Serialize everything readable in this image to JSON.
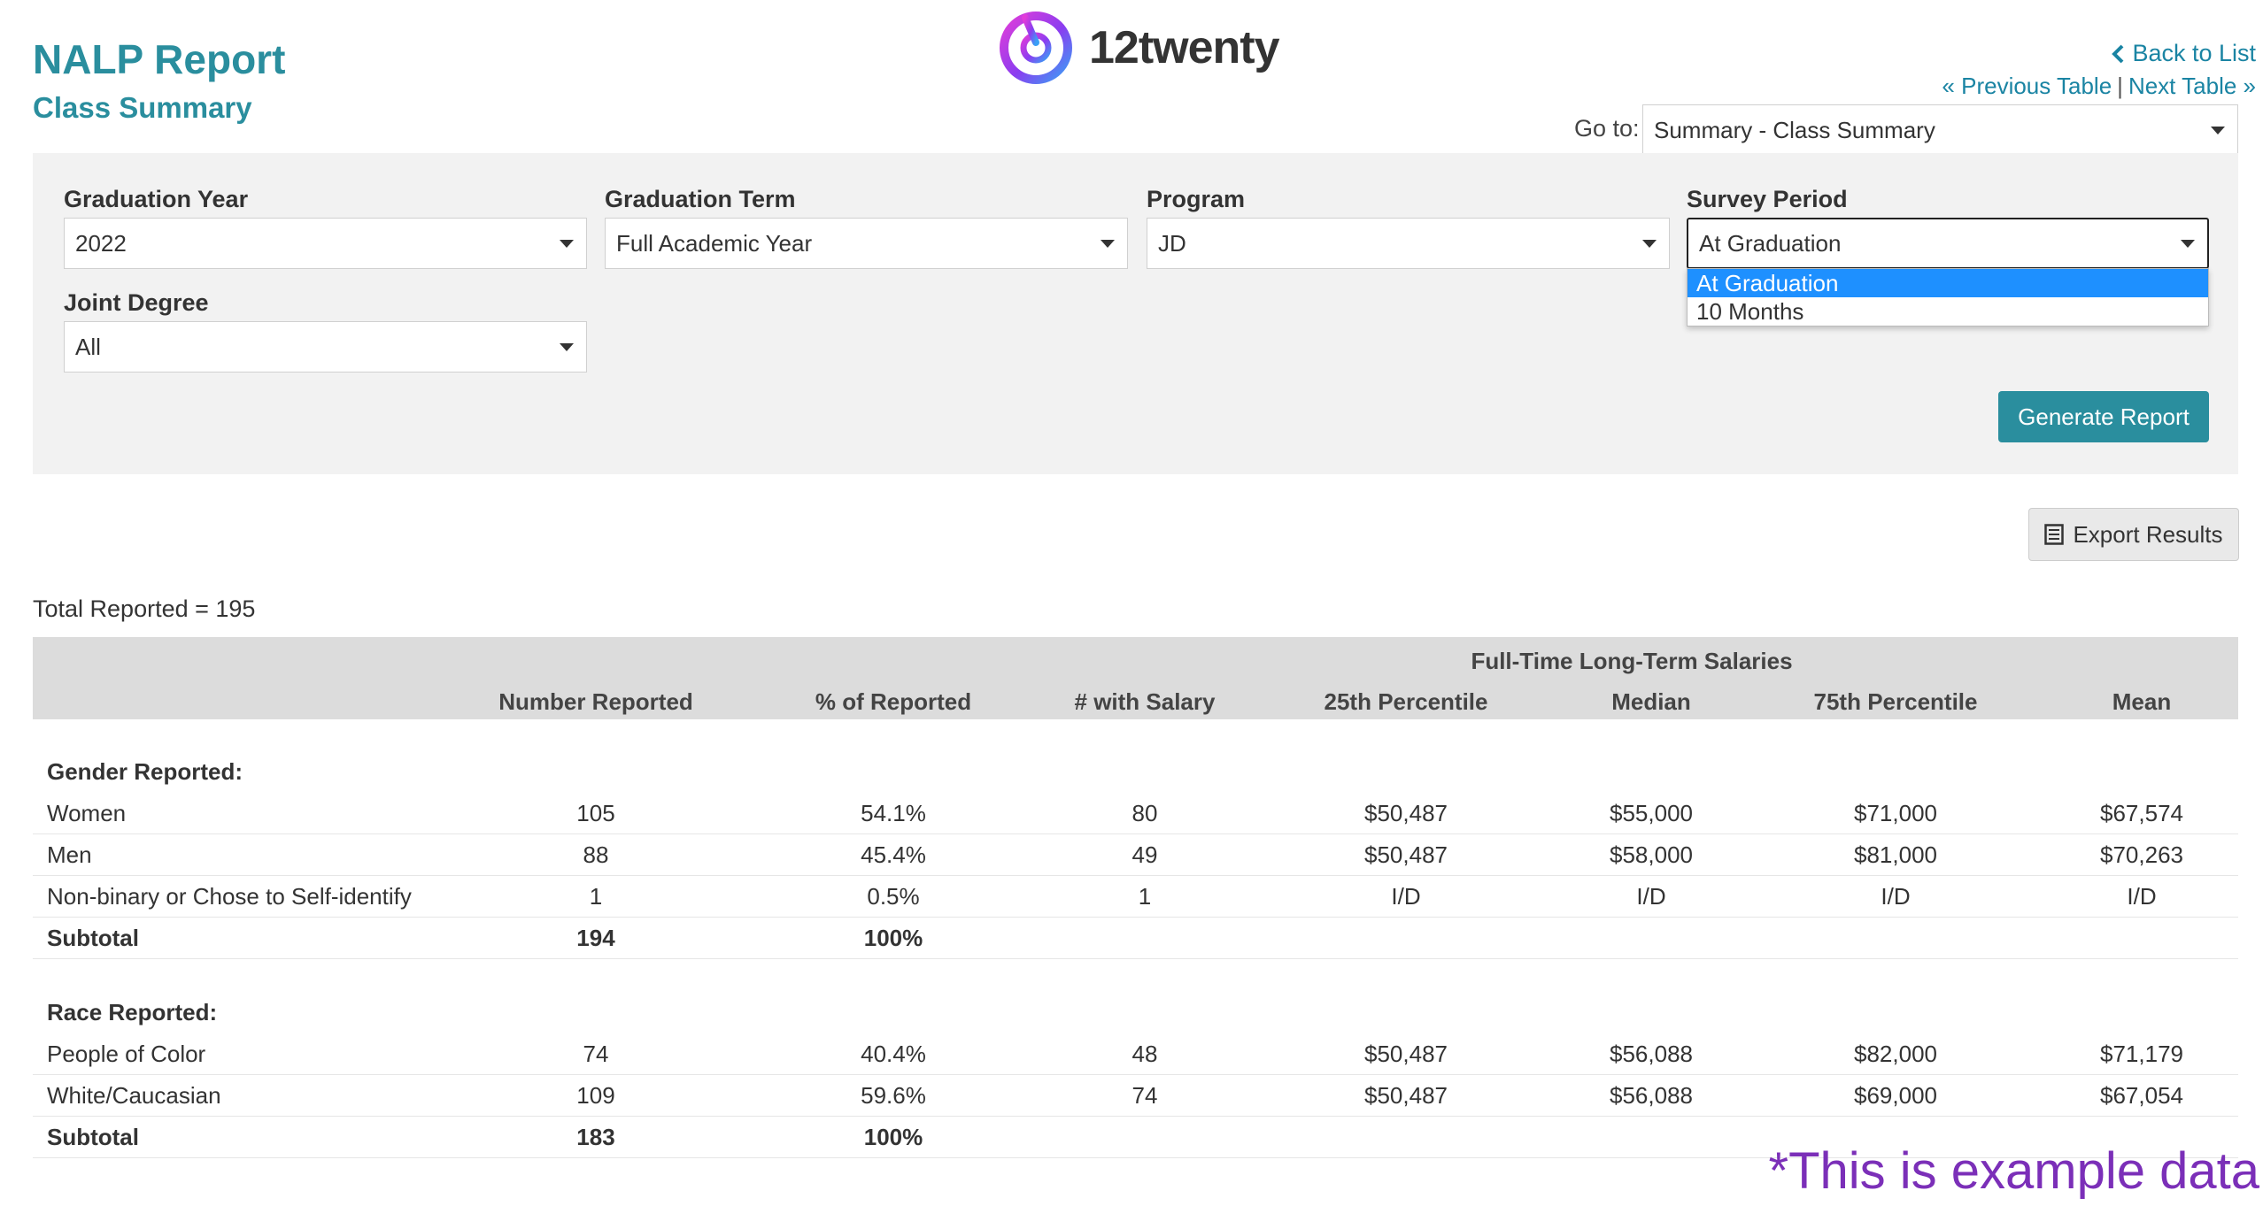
{
  "header": {
    "title": "NALP Report",
    "subtitle": "Class Summary",
    "logo_text": "12twenty",
    "back_label": "Back to List",
    "prev_label": "« Previous Table",
    "next_label": "Next Table »",
    "goto_label": "Go to:",
    "goto_value": "Summary - Class Summary"
  },
  "filters": {
    "graduation_year": {
      "label": "Graduation Year",
      "value": "2022"
    },
    "graduation_term": {
      "label": "Graduation Term",
      "value": "Full Academic Year"
    },
    "program": {
      "label": "Program",
      "value": "JD"
    },
    "survey_period": {
      "label": "Survey Period",
      "value": "At Graduation",
      "options": [
        "At Graduation",
        "10 Months"
      ]
    },
    "joint_degree": {
      "label": "Joint Degree",
      "value": "All"
    },
    "generate_label": "Generate Report"
  },
  "export_label": "Export Results",
  "total_reported": "Total Reported = 195",
  "table": {
    "group_header": "Full-Time Long-Term Salaries",
    "columns": [
      "Number Reported",
      "% of Reported",
      "# with Salary",
      "25th Percentile",
      "Median",
      "75th Percentile",
      "Mean"
    ],
    "sections": [
      {
        "title": "Gender Reported:",
        "rows": [
          {
            "label": "Women",
            "values": [
              "105",
              "54.1%",
              "80",
              "$50,487",
              "$55,000",
              "$71,000",
              "$67,574"
            ]
          },
          {
            "label": "Men",
            "values": [
              "88",
              "45.4%",
              "49",
              "$50,487",
              "$58,000",
              "$81,000",
              "$70,263"
            ]
          },
          {
            "label": "Non-binary or Chose to Self-identify",
            "values": [
              "1",
              "0.5%",
              "1",
              "I/D",
              "I/D",
              "I/D",
              "I/D"
            ]
          }
        ],
        "subtotal": {
          "label": "Subtotal",
          "values": [
            "194",
            "100%"
          ]
        }
      },
      {
        "title": "Race Reported:",
        "rows": [
          {
            "label": "People of Color",
            "values": [
              "74",
              "40.4%",
              "48",
              "$50,487",
              "$56,088",
              "$82,000",
              "$71,179"
            ]
          },
          {
            "label": "White/Caucasian",
            "values": [
              "109",
              "59.6%",
              "74",
              "$50,487",
              "$56,088",
              "$69,000",
              "$67,054"
            ]
          }
        ],
        "subtotal": {
          "label": "Subtotal",
          "values": [
            "183",
            "100%"
          ]
        }
      }
    ]
  },
  "watermark": "*This is example data",
  "colors": {
    "accent": "#2a8e9e",
    "link": "#1a84a3",
    "dropdown_selected": "#1e90ff",
    "watermark": "#7b2fb8"
  }
}
